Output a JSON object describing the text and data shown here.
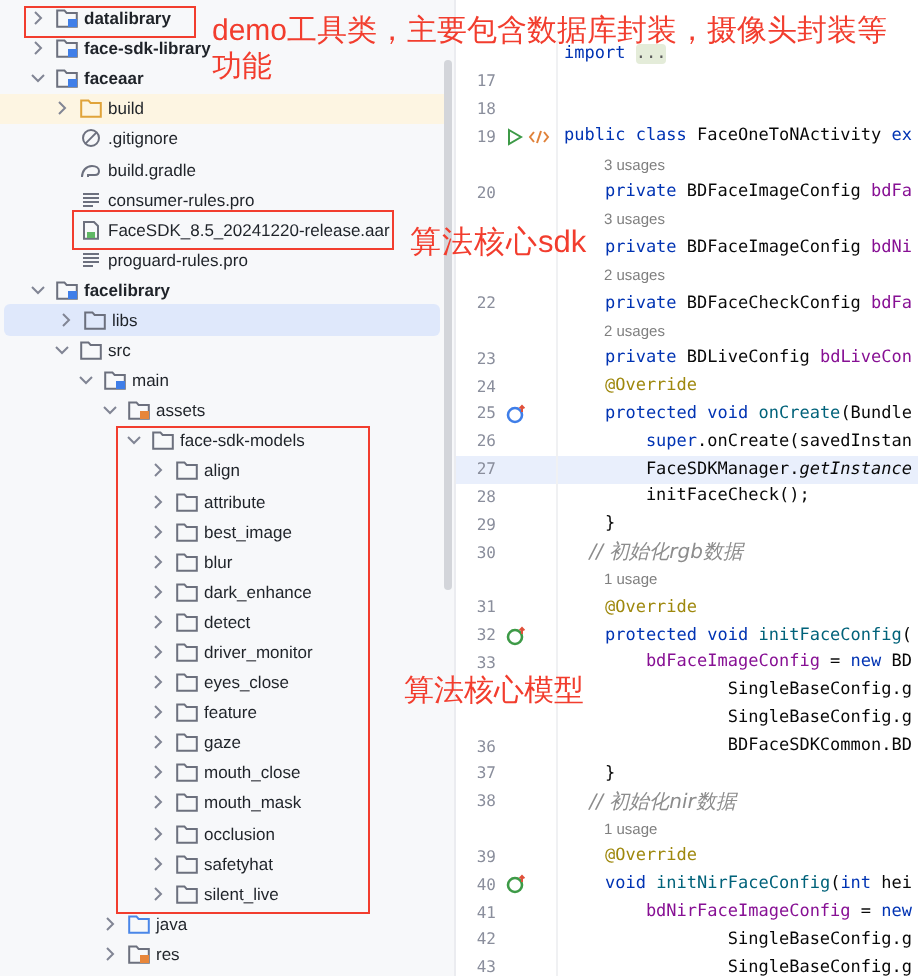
{
  "tree": [
    {
      "label": "datalibrary",
      "kind": "module",
      "expanded": false,
      "selected": false
    },
    {
      "label": "face-sdk-library",
      "kind": "module",
      "expanded": false,
      "selected": false
    },
    {
      "label": "faceaar",
      "kind": "module",
      "expanded": true,
      "selected": false,
      "children": [
        {
          "label": "build",
          "kind": "excluded-folder",
          "expanded": false,
          "selected": false
        },
        {
          "label": ".gitignore",
          "kind": "ignore-file",
          "selected": false
        },
        {
          "label": "build.gradle",
          "kind": "gradle-file",
          "selected": false
        },
        {
          "label": "consumer-rules.pro",
          "kind": "text-file",
          "selected": false
        },
        {
          "label": "FaceSDK_8.5_20241220-release.aar",
          "kind": "archive-file",
          "selected": false
        },
        {
          "label": "proguard-rules.pro",
          "kind": "text-file",
          "selected": false
        }
      ]
    },
    {
      "label": "facelibrary",
      "kind": "module",
      "expanded": true,
      "selected": false,
      "children": [
        {
          "label": "libs",
          "kind": "folder",
          "expanded": false,
          "selected": true
        },
        {
          "label": "src",
          "kind": "folder",
          "expanded": true,
          "selected": false,
          "children": [
            {
              "label": "main",
              "kind": "module-folder",
              "expanded": true,
              "selected": false,
              "children": [
                {
                  "label": "assets",
                  "kind": "resource-folder",
                  "expanded": true,
                  "selected": false,
                  "children": [
                    {
                      "label": "face-sdk-models",
                      "kind": "folder",
                      "expanded": true,
                      "selected": false,
                      "children": [
                        {
                          "label": "align",
                          "kind": "folder",
                          "expanded": false,
                          "selected": false
                        },
                        {
                          "label": "attribute",
                          "kind": "folder",
                          "expanded": false,
                          "selected": false
                        },
                        {
                          "label": "best_image",
                          "kind": "folder",
                          "expanded": false,
                          "selected": false
                        },
                        {
                          "label": "blur",
                          "kind": "folder",
                          "expanded": false,
                          "selected": false
                        },
                        {
                          "label": "dark_enhance",
                          "kind": "folder",
                          "expanded": false,
                          "selected": false
                        },
                        {
                          "label": "detect",
                          "kind": "folder",
                          "expanded": false,
                          "selected": false
                        },
                        {
                          "label": "driver_monitor",
                          "kind": "folder",
                          "expanded": false,
                          "selected": false
                        },
                        {
                          "label": "eyes_close",
                          "kind": "folder",
                          "expanded": false,
                          "selected": false
                        },
                        {
                          "label": "feature",
                          "kind": "folder",
                          "expanded": false,
                          "selected": false
                        },
                        {
                          "label": "gaze",
                          "kind": "folder",
                          "expanded": false,
                          "selected": false
                        },
                        {
                          "label": "mouth_close",
                          "kind": "folder",
                          "expanded": false,
                          "selected": false
                        },
                        {
                          "label": "mouth_mask",
                          "kind": "folder",
                          "expanded": false,
                          "selected": false
                        },
                        {
                          "label": "occlusion",
                          "kind": "folder",
                          "expanded": false,
                          "selected": false
                        },
                        {
                          "label": "safetyhat",
                          "kind": "folder",
                          "expanded": false,
                          "selected": false
                        },
                        {
                          "label": "silent_live",
                          "kind": "folder",
                          "expanded": false,
                          "selected": false
                        }
                      ]
                    }
                  ]
                },
                {
                  "label": "java",
                  "kind": "source-folder",
                  "expanded": false,
                  "selected": false
                },
                {
                  "label": "res",
                  "kind": "resource-folder",
                  "expanded": false,
                  "selected": false
                }
              ]
            }
          ]
        }
      ]
    }
  ],
  "editor": {
    "lines": [
      {
        "kind": "code",
        "tokens": [
          {
            "text": "import ",
            "kind": "keyword"
          },
          {
            "text": "...",
            "kind": "folded"
          }
        ]
      },
      {
        "kind": "code",
        "number": "17"
      },
      {
        "kind": "code",
        "number": "18"
      },
      {
        "kind": "code",
        "number": "19",
        "gutter": [
          {
            "kind": "run"
          },
          {
            "kind": "xml"
          }
        ],
        "tokens": [
          {
            "text": "public class ",
            "kind": "keyword"
          },
          {
            "text": "FaceOneToNActivity ",
            "kind": "plain"
          },
          {
            "text": "ex",
            "kind": "keyword"
          }
        ]
      },
      {
        "kind": "hint",
        "text": "3 usages"
      },
      {
        "kind": "code",
        "number": "20",
        "tokens": [
          {
            "text": "    private ",
            "kind": "keyword"
          },
          {
            "text": "BDFaceImageConfig ",
            "kind": "plain"
          },
          {
            "text": "bdFa",
            "kind": "field"
          }
        ]
      },
      {
        "kind": "hint",
        "text": "3 usages"
      },
      {
        "kind": "code",
        "tokens": [
          {
            "text": "    private ",
            "kind": "keyword"
          },
          {
            "text": "BDFaceImageConfig ",
            "kind": "plain"
          },
          {
            "text": "bdNi",
            "kind": "field"
          }
        ]
      },
      {
        "kind": "hint",
        "text": "2 usages"
      },
      {
        "kind": "code",
        "number": "22",
        "tokens": [
          {
            "text": "    private ",
            "kind": "keyword"
          },
          {
            "text": "BDFaceCheckConfig ",
            "kind": "plain"
          },
          {
            "text": "bdFa",
            "kind": "field"
          }
        ]
      },
      {
        "kind": "hint",
        "text": "2 usages"
      },
      {
        "kind": "code",
        "number": "23",
        "tokens": [
          {
            "text": "    private ",
            "kind": "keyword"
          },
          {
            "text": "BDLiveConfig ",
            "kind": "plain"
          },
          {
            "text": "bdLiveCon",
            "kind": "field"
          }
        ]
      },
      {
        "kind": "code",
        "number": "24",
        "tokens": [
          {
            "text": "    @Override",
            "kind": "annotation"
          }
        ]
      },
      {
        "kind": "code",
        "number": "25",
        "gutter": [
          {
            "kind": "override"
          }
        ],
        "tokens": [
          {
            "text": "    protected void ",
            "kind": "keyword"
          },
          {
            "text": "onCreate",
            "kind": "method"
          },
          {
            "text": "(Bundle",
            "kind": "plain"
          }
        ]
      },
      {
        "kind": "code",
        "number": "26",
        "tokens": [
          {
            "text": "        super",
            "kind": "keyword"
          },
          {
            "text": ".onCreate(savedInstan",
            "kind": "plain"
          }
        ]
      },
      {
        "kind": "code",
        "number": "27",
        "current": true,
        "tokens": [
          {
            "text": "        FaceSDKManager.",
            "kind": "plain"
          },
          {
            "text": "getInstance",
            "kind": "static"
          }
        ]
      },
      {
        "kind": "code",
        "number": "28",
        "tokens": [
          {
            "text": "        initFaceCheck();",
            "kind": "plain"
          }
        ]
      },
      {
        "kind": "code",
        "number": "29",
        "tokens": [
          {
            "text": "    }",
            "kind": "plain"
          }
        ]
      },
      {
        "kind": "code",
        "number": "30",
        "tokens": [
          {
            "text": "    // 初始化rgb数据",
            "kind": "comment"
          }
        ]
      },
      {
        "kind": "hint",
        "text": "1 usage"
      },
      {
        "kind": "code",
        "number": "31",
        "tokens": [
          {
            "text": "    @Override",
            "kind": "annotation"
          }
        ]
      },
      {
        "kind": "code",
        "number": "32",
        "gutter": [
          {
            "kind": "implement"
          }
        ],
        "tokens": [
          {
            "text": "    protected void ",
            "kind": "keyword"
          },
          {
            "text": "initFaceConfig",
            "kind": "method"
          },
          {
            "text": "(",
            "kind": "plain"
          }
        ]
      },
      {
        "kind": "code",
        "number": "33",
        "tokens": [
          {
            "text": "        bdFaceImageConfig",
            "kind": "field"
          },
          {
            "text": " = ",
            "kind": "plain"
          },
          {
            "text": "new",
            "kind": "keyword"
          },
          {
            "text": " BD",
            "kind": "plain"
          }
        ]
      },
      {
        "kind": "code",
        "tokens": [
          {
            "text": "                SingleBaseConfig.g",
            "kind": "plain"
          }
        ]
      },
      {
        "kind": "code",
        "tokens": [
          {
            "text": "                SingleBaseConfig.g",
            "kind": "plain"
          }
        ]
      },
      {
        "kind": "code",
        "number": "36",
        "tokens": [
          {
            "text": "                BDFaceSDKCommon.BD",
            "kind": "plain"
          }
        ]
      },
      {
        "kind": "code",
        "number": "37",
        "tokens": [
          {
            "text": "    }",
            "kind": "plain"
          }
        ]
      },
      {
        "kind": "code",
        "number": "38",
        "tokens": [
          {
            "text": "    // 初始化nir数据",
            "kind": "comment"
          }
        ]
      },
      {
        "kind": "hint",
        "text": "1 usage"
      },
      {
        "kind": "code",
        "number": "39",
        "tokens": [
          {
            "text": "    @Override",
            "kind": "annotation"
          }
        ]
      },
      {
        "kind": "code",
        "number": "40",
        "gutter": [
          {
            "kind": "implement"
          }
        ],
        "tokens": [
          {
            "text": "    void ",
            "kind": "keyword"
          },
          {
            "text": "initNirFaceConfig",
            "kind": "method"
          },
          {
            "text": "(",
            "kind": "plain"
          },
          {
            "text": "int",
            "kind": "keyword"
          },
          {
            "text": " hei",
            "kind": "plain"
          }
        ]
      },
      {
        "kind": "code",
        "number": "41",
        "tokens": [
          {
            "text": "        bdNirFaceImageConfig",
            "kind": "field"
          },
          {
            "text": " = ",
            "kind": "plain"
          },
          {
            "text": "new",
            "kind": "keyword"
          }
        ]
      },
      {
        "kind": "code",
        "number": "42",
        "tokens": [
          {
            "text": "                SingleBaseConfig.g",
            "kind": "plain"
          }
        ]
      },
      {
        "kind": "code",
        "number": "43",
        "tokens": [
          {
            "text": "                SingleBaseConfig.g",
            "kind": "plain"
          }
        ]
      }
    ]
  },
  "annotations": [
    {
      "lines": [
        "demo工具类，主要包含数据库封装，摄像头封装等",
        "功能"
      ]
    },
    {
      "lines": [
        "算法核心sdk"
      ]
    },
    {
      "lines": [
        "算法核心模型"
      ]
    }
  ]
}
